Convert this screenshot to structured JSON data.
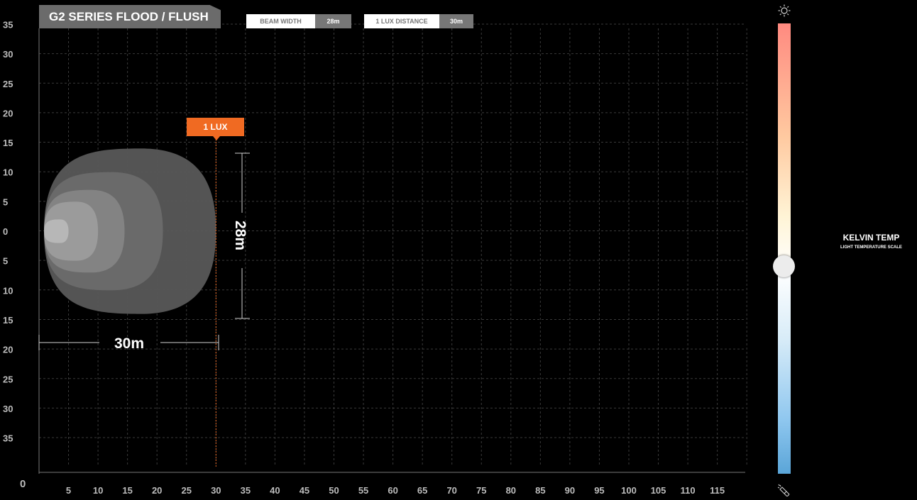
{
  "title": "G2 SERIES FLOOD / FLUSH",
  "beam_width": {
    "label": "BEAM WIDTH",
    "value": "28m"
  },
  "lux_distance": {
    "label": "1 LUX DISTANCE",
    "value": "30m"
  },
  "lux_marker": "1 LUX",
  "dim_width_label": "28m",
  "dim_distance_label": "30m",
  "kelvin": {
    "title": "KELVIN TEMP",
    "subtitle": "LIGHT TEMPERATURE SCALE",
    "level": 0.54
  },
  "icons": {
    "top": "sun-icon",
    "bottom": "flashlight-icon"
  },
  "colors": {
    "accent": "#f06a22",
    "grid": "#3a3a3a",
    "beam": "#5f5f5f"
  },
  "chart_data": {
    "type": "area",
    "x_axis": {
      "origin_label": "0",
      "ticks": [
        5,
        10,
        15,
        20,
        25,
        30,
        35,
        40,
        45,
        50,
        55,
        60,
        65,
        70,
        75,
        80,
        85,
        90,
        95,
        100,
        105,
        110,
        115
      ],
      "range": [
        0,
        120
      ]
    },
    "y_axis": {
      "tick_labels": [
        "35",
        "30",
        "25",
        "20",
        "15",
        "10",
        "5",
        "0",
        "5",
        "10",
        "15",
        "20",
        "25",
        "30",
        "35"
      ],
      "values": [
        35,
        30,
        25,
        20,
        15,
        10,
        5,
        0,
        -5,
        -10,
        -15,
        -20,
        -25,
        -30,
        -35
      ],
      "range": [
        -40,
        35
      ]
    },
    "grid": true,
    "beam_contours": [
      {
        "distance": 30,
        "width": 28
      },
      {
        "distance": 21,
        "width": 20
      },
      {
        "distance": 14.5,
        "width": 14
      },
      {
        "distance": 10,
        "width": 10
      },
      {
        "distance": 5,
        "width": 4
      }
    ],
    "one_lux_distance": 30,
    "beam_width": 28
  }
}
